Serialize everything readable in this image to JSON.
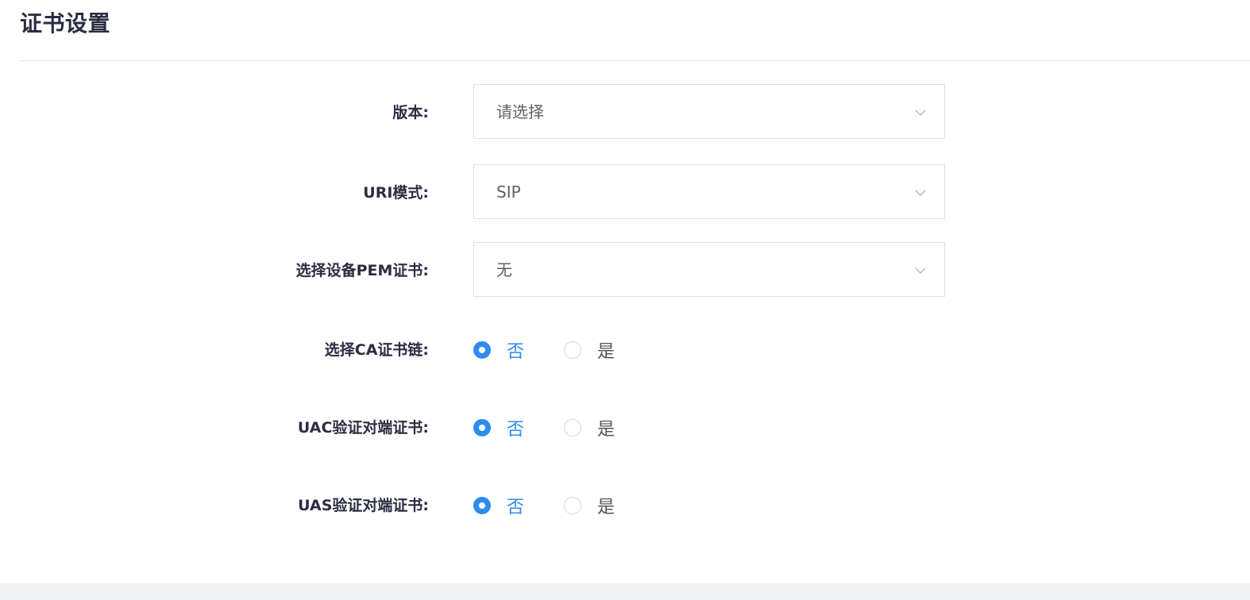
{
  "page": {
    "title": "证书设置"
  },
  "form": {
    "version": {
      "label": "版本:",
      "value": "请选择",
      "is_placeholder": true,
      "dropdown_icon": "chevron-down-icon"
    },
    "uri_mode": {
      "label": "URI模式:",
      "value": "SIP",
      "dropdown_icon": "chevron-down-icon"
    },
    "device_pem": {
      "label": "选择设备PEM证书:",
      "value": "无",
      "dropdown_icon": "chevron-down-icon"
    },
    "ca_chain": {
      "label": "选择CA证书链:",
      "options": [
        "否",
        "是"
      ],
      "selected": "否"
    },
    "uac_verify": {
      "label": "UAC验证对端证书:",
      "options": [
        "否",
        "是"
      ],
      "selected": "否"
    },
    "uas_verify": {
      "label": "UAS验证对端证书:",
      "options": [
        "否",
        "是"
      ],
      "selected": "否"
    }
  },
  "colors": {
    "accent": "#2d8cf0",
    "label_text": "#2b2d42",
    "border": "#dcdfe6",
    "footer_background": "#f0f2f5"
  }
}
